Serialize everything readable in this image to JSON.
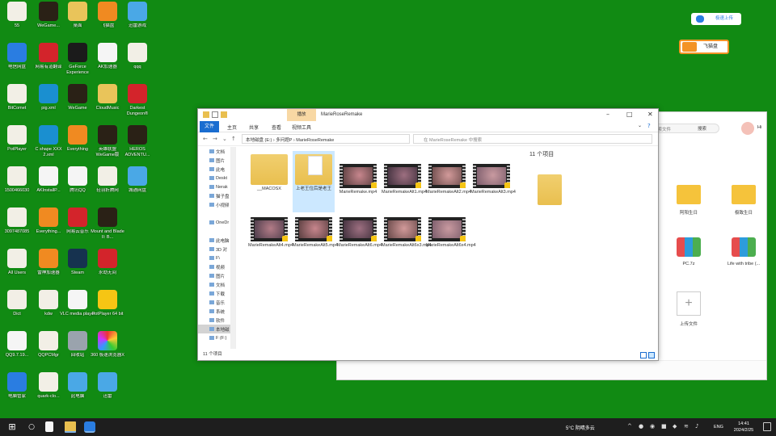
{
  "desktop": {
    "icons": [
      {
        "label": "55",
        "icon": "file-icon",
        "color": "file"
      },
      {
        "label": "WeGame...",
        "icon": "wegame-icon",
        "color": "dark"
      },
      {
        "label": "桌面",
        "icon": "folder-icon",
        "color": "folder"
      },
      {
        "label": "飞猫盘",
        "icon": "feimao-icon",
        "color": "orange"
      },
      {
        "label": "迅雷游戏",
        "icon": "xunlei-icon",
        "color": "sky"
      },
      {
        "label": "电信网盘",
        "icon": "cloud-icon",
        "color": "blue"
      },
      {
        "label": "网易有道翻译",
        "icon": "youdao-icon",
        "color": "red"
      },
      {
        "label": "GeForce Experience",
        "icon": "nvidia-icon",
        "color": "nv"
      },
      {
        "label": "AK加速器",
        "icon": "ak-icon",
        "color": "white"
      },
      {
        "label": "qqq",
        "icon": "file-icon",
        "color": "file"
      },
      {
        "label": "BitComet",
        "icon": "file-icon",
        "color": "file"
      },
      {
        "label": "pig.xml",
        "icon": "edge-icon",
        "color": "edge"
      },
      {
        "label": "WeGame",
        "icon": "wegame-icon",
        "color": "dark"
      },
      {
        "label": "CloudMusic",
        "icon": "folder-icon",
        "color": "folder"
      },
      {
        "label": "Darkest Dungeon®",
        "icon": "darkest-dungeon-icon",
        "color": "red"
      },
      {
        "label": "PotPlayer",
        "icon": "file-icon",
        "color": "file"
      },
      {
        "label": "C shape XXX 2.xml",
        "icon": "edge-icon",
        "color": "edge"
      },
      {
        "label": "Everything",
        "icon": "search-icon",
        "color": "orange"
      },
      {
        "label": "英雄联盟 WeGame版",
        "icon": "lol-icon",
        "color": "dark"
      },
      {
        "label": "HEROS ADVENTU...",
        "icon": "heroes-icon",
        "color": "dark"
      },
      {
        "label": "1500466030",
        "icon": "file-icon",
        "color": "file"
      },
      {
        "label": "AKInstallP...",
        "icon": "ak-icon",
        "color": "white"
      },
      {
        "label": "腾讯QQ",
        "icon": "qq-icon",
        "color": "white"
      },
      {
        "label": "轻羽折腾网",
        "icon": "file-icon",
        "color": "file"
      },
      {
        "label": "城通网盘",
        "icon": "cloud-icon",
        "color": "sky"
      },
      {
        "label": "3097487085",
        "icon": "file-icon",
        "color": "file"
      },
      {
        "label": "Everything...",
        "icon": "search-icon",
        "color": "orange"
      },
      {
        "label": "网易云音乐",
        "icon": "netease-music-icon",
        "color": "red"
      },
      {
        "label": "Mount and Blade II: B...",
        "icon": "game-icon",
        "color": "dark"
      },
      {
        "label": "",
        "icon": "",
        "color": ""
      },
      {
        "label": "All Users",
        "icon": "file-icon",
        "color": "file"
      },
      {
        "label": "雷神加速器",
        "icon": "leishen-icon",
        "color": "orange"
      },
      {
        "label": "Steam",
        "icon": "steam-icon",
        "color": "steam"
      },
      {
        "label": "永劫无间",
        "icon": "game-icon",
        "color": "red"
      },
      {
        "label": "",
        "icon": "",
        "color": ""
      },
      {
        "label": "Dict",
        "icon": "file-icon",
        "color": "file"
      },
      {
        "label": "kdw",
        "icon": "file-icon",
        "color": "file"
      },
      {
        "label": "VLC media player",
        "icon": "vlc-icon",
        "color": "white"
      },
      {
        "label": "PotPlayer 64 bit",
        "icon": "potplayer-icon",
        "color": "yellow"
      },
      {
        "label": "",
        "icon": "",
        "color": ""
      },
      {
        "label": "QQ9.7.19...",
        "icon": "qq-icon",
        "color": "white"
      },
      {
        "label": "QQPCMgr",
        "icon": "file-icon",
        "color": "file"
      },
      {
        "label": "回收站",
        "icon": "recycle-bin-icon",
        "color": "gray"
      },
      {
        "label": "360 极速浏览器X",
        "icon": "browser360-icon",
        "color": "rainbow"
      },
      {
        "label": "",
        "icon": "",
        "color": ""
      },
      {
        "label": "电脑管家",
        "icon": "shield-icon",
        "color": "blue"
      },
      {
        "label": "quark-clo...",
        "icon": "file-icon",
        "color": "file"
      },
      {
        "label": "此电脑",
        "icon": "computer-icon",
        "color": "sky"
      },
      {
        "label": "迅雷",
        "icon": "xunlei-icon",
        "color": "sky"
      }
    ]
  },
  "widgets": {
    "upload_label": "极速上传",
    "feimao_label": "飞猫盘"
  },
  "app2": {
    "search_placeholder": "搜索文件",
    "search_btn": "搜索",
    "greeting": "Hi",
    "items": [
      {
        "label": "阿阳生日",
        "type": "folder"
      },
      {
        "label": "极致生日",
        "type": "folder"
      },
      {
        "label": "PC.7z",
        "type": "zip"
      },
      {
        "label": "Life with tribe (...",
        "type": "zip"
      },
      {
        "label": "上传文件",
        "type": "new"
      }
    ]
  },
  "explorer": {
    "title": "MarieRoseRemake",
    "manage_tab": "播放",
    "ribbon": {
      "file": "文件",
      "home": "主页",
      "share": "共享",
      "view": "查看",
      "video_tools": "视频工具"
    },
    "address": [
      "本地磁盘 (E:)",
      "多问题P",
      "MarieRoseRemake"
    ],
    "search_placeholder": "在 MarieRoseRemake 中搜索",
    "sidebar": [
      {
        "label": "文档",
        "sel": false
      },
      {
        "label": "图片",
        "sel": false
      },
      {
        "label": "此电",
        "sel": false
      },
      {
        "label": "Deskt",
        "sel": false
      },
      {
        "label": "Nerak",
        "sel": false
      },
      {
        "label": "猫子盘",
        "sel": false
      },
      {
        "label": "小视频",
        "sel": false
      },
      {
        "label": "",
        "sel": false
      },
      {
        "label": "OneDr",
        "sel": false
      },
      {
        "label": "",
        "sel": false
      },
      {
        "label": "此电脑",
        "sel": false
      },
      {
        "label": "3D 对",
        "sel": false
      },
      {
        "label": "F\\",
        "sel": false
      },
      {
        "label": "视频",
        "sel": false
      },
      {
        "label": "图片",
        "sel": false
      },
      {
        "label": "文档",
        "sel": false
      },
      {
        "label": "下载",
        "sel": false
      },
      {
        "label": "音乐",
        "sel": false
      },
      {
        "label": "系统",
        "sel": false
      },
      {
        "label": "软件",
        "sel": false
      },
      {
        "label": "本地磁",
        "sel": true
      },
      {
        "label": "F (F:)",
        "sel": false
      }
    ],
    "files": [
      {
        "name": "__MACOSX",
        "type": "folder",
        "selected": false
      },
      {
        "name": "上老王位后是老王",
        "type": "folder-doc",
        "selected": true
      },
      {
        "name": "MarieRemake.mp4",
        "type": "video",
        "selected": false
      },
      {
        "name": "MarieRemakeAlt1.mp4",
        "type": "video",
        "selected": false
      },
      {
        "name": "MarieRemakeAlt2.mp4",
        "type": "video",
        "selected": false
      },
      {
        "name": "MarieRemakeAlt3.mp4",
        "type": "video",
        "selected": false
      },
      {
        "name": "MarieRemakeAlt4.mp4",
        "type": "video",
        "selected": false
      },
      {
        "name": "MarieRemakeAlt5.mp4",
        "type": "video",
        "selected": false
      },
      {
        "name": "MarieRemakeAlt6.mp4",
        "type": "video",
        "selected": false
      },
      {
        "name": "MarieRemakeAlt6x3.mp4",
        "type": "video",
        "selected": false
      },
      {
        "name": "MarieRemakeAlt6x4.mp4",
        "type": "video",
        "selected": false
      }
    ],
    "item_count": "11 个项目",
    "status": "11 个项目"
  },
  "taskbar": {
    "weather": "5°C 阴晴多云",
    "lang": "ENG",
    "time": "14:41",
    "date": "2024/2/25"
  }
}
